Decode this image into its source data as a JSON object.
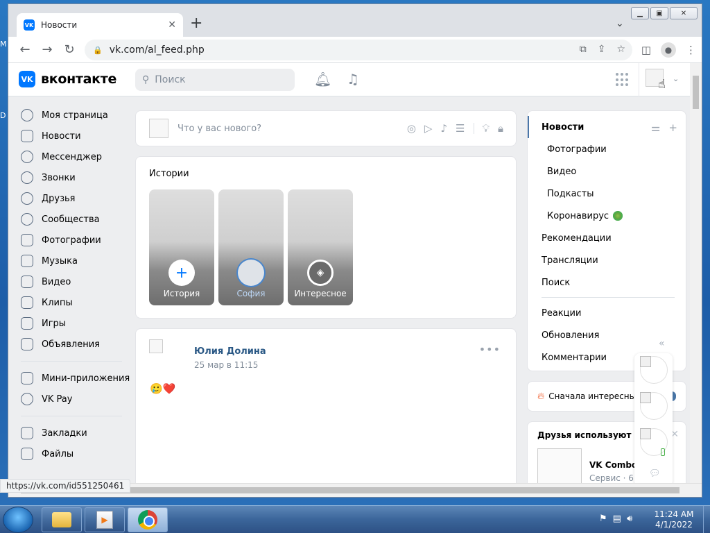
{
  "browser": {
    "tab_title": "Новости",
    "tab_favicon": "VK",
    "url": "vk.com/al_feed.php",
    "status_url": "https://vk.com/id551250461"
  },
  "vk": {
    "logo_text": "вконтакте",
    "logo_mark": "VK",
    "search_placeholder": "Поиск"
  },
  "left_nav": {
    "items": [
      {
        "label": "Моя страница",
        "icon": "user-circle-icon"
      },
      {
        "label": "Новости",
        "icon": "news-icon"
      },
      {
        "label": "Мессенджер",
        "icon": "message-icon"
      },
      {
        "label": "Звонки",
        "icon": "phone-icon"
      },
      {
        "label": "Друзья",
        "icon": "friends-icon"
      },
      {
        "label": "Сообщества",
        "icon": "communities-icon"
      },
      {
        "label": "Фотографии",
        "icon": "photo-icon"
      },
      {
        "label": "Музыка",
        "icon": "music-icon"
      },
      {
        "label": "Видео",
        "icon": "video-icon"
      },
      {
        "label": "Клипы",
        "icon": "clips-icon"
      },
      {
        "label": "Игры",
        "icon": "gamepad-icon"
      },
      {
        "label": "Объявления",
        "icon": "ads-icon"
      }
    ],
    "items2": [
      {
        "label": "Мини-приложения",
        "icon": "apps-icon"
      },
      {
        "label": "VK Pay",
        "icon": "vkpay-icon"
      }
    ],
    "items3": [
      {
        "label": "Закладки",
        "icon": "star-icon"
      },
      {
        "label": "Файлы",
        "icon": "file-icon"
      }
    ]
  },
  "composer": {
    "placeholder": "Что у вас нового?"
  },
  "stories": {
    "title": "Истории",
    "items": [
      {
        "label": "История"
      },
      {
        "label": "София"
      },
      {
        "label": "Интересное"
      }
    ]
  },
  "post": {
    "author": "Юлия Долина",
    "date": "25 мар в 11:15",
    "text": "🥲❤️",
    "more": "•••"
  },
  "right_menu": {
    "items": [
      {
        "label": "Новости"
      },
      {
        "label": "Фотографии"
      },
      {
        "label": "Видео"
      },
      {
        "label": "Подкасты"
      },
      {
        "label": "Коронавирус"
      },
      {
        "label": "Рекомендации"
      },
      {
        "label": "Трансляции"
      },
      {
        "label": "Поиск"
      },
      {
        "label": "Реакции"
      },
      {
        "label": "Обновления"
      },
      {
        "label": "Комментарии"
      }
    ]
  },
  "sort": {
    "label": "Сначала интересные"
  },
  "friends_use": {
    "title": "Друзья используют",
    "app_name": "VK Combo",
    "app_sub": "Сервис · 6"
  },
  "taskbar": {
    "time": "11:24 AM",
    "date": "4/1/2022"
  },
  "colors": {
    "vk_blue": "#0077ff",
    "link_blue": "#2a5885",
    "page_bg": "#edeef0"
  }
}
